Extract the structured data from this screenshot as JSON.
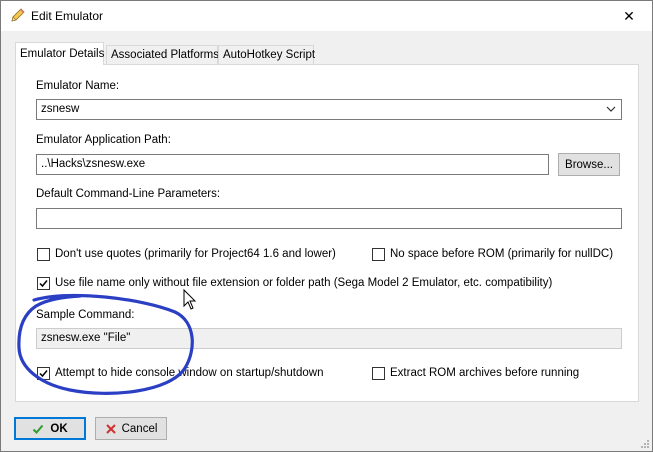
{
  "window": {
    "title": "Edit Emulator",
    "close_glyph": "✕"
  },
  "tabs": [
    {
      "label": "Emulator Details",
      "active": true
    },
    {
      "label": "Associated Platforms",
      "active": false
    },
    {
      "label": "AutoHotkey Script",
      "active": false
    }
  ],
  "form": {
    "emulator_name_label": "Emulator Name:",
    "emulator_name_value": "zsnesw",
    "app_path_label": "Emulator Application Path:",
    "app_path_value": "..\\Hacks\\zsnesw.exe",
    "browse_label": "Browse...",
    "params_label": "Default Command-Line Parameters:",
    "params_value": "",
    "sample_label": "Sample Command:",
    "sample_value": "zsnesw.exe \"File\""
  },
  "checkboxes": {
    "no_quotes": {
      "label": "Don't use quotes (primarily for Project64 1.6 and lower)",
      "checked": false
    },
    "no_space": {
      "label": "No space before ROM (primarily for nullDC)",
      "checked": false
    },
    "file_name_only": {
      "label": "Use file name only without file extension or folder path (Sega Model 2 Emulator, etc. compatibility)",
      "checked": true
    },
    "hide_console": {
      "label": "Attempt to hide console window on startup/shutdown",
      "checked": true
    },
    "extract_rom": {
      "label": "Extract ROM archives before running",
      "checked": false
    }
  },
  "buttons": {
    "ok_label": "OK",
    "cancel_label": "Cancel"
  },
  "colors": {
    "annotation": "#2b3fc4",
    "focus_border": "#0078d7",
    "check_mark": "#000000",
    "ok_icon": "#2e9e2e",
    "cancel_icon": "#d03030"
  }
}
